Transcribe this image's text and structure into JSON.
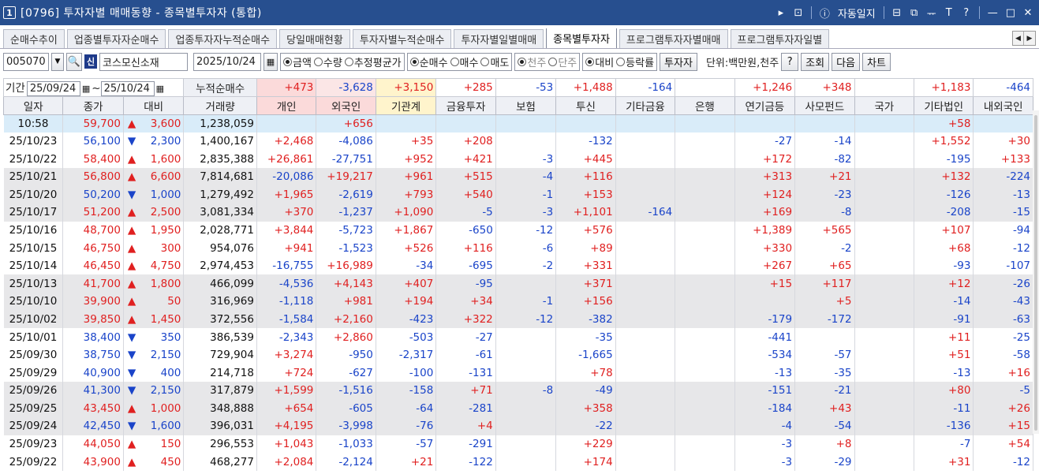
{
  "window": {
    "number_badge": "1",
    "title": "[0796] 투자자별 매매동향 - 종목별투자자 (통합)",
    "auto_journal": "자동일지",
    "controls": [
      "▸",
      "⊡",
      "ⓘ",
      "⧉",
      "⊟",
      "ᅲ",
      "T",
      "?",
      "—",
      "□",
      "✕"
    ]
  },
  "tabs": [
    {
      "label": "순매수추이",
      "active": false
    },
    {
      "label": "업종별투자자순매수",
      "active": false
    },
    {
      "label": "업종투자자누적순매수",
      "active": false
    },
    {
      "label": "당일매매현황",
      "active": false
    },
    {
      "label": "투자자별누적순매수",
      "active": false
    },
    {
      "label": "투자자별일별매매",
      "active": false
    },
    {
      "label": "종목별투자자",
      "active": true
    },
    {
      "label": "프로그램투자자별매매",
      "active": false
    },
    {
      "label": "프로그램투자자일별",
      "active": false
    }
  ],
  "toolbar": {
    "stock_code": "005070",
    "market_badge": "신",
    "stock_name": "코스모신소재",
    "date": "2025/10/24",
    "mode_options": [
      {
        "label": "금액",
        "on": true
      },
      {
        "label": "수량",
        "on": false
      },
      {
        "label": "추정평균가",
        "on": false
      }
    ],
    "trade_options": [
      {
        "label": "순매수",
        "on": true
      },
      {
        "label": "매수",
        "on": false
      },
      {
        "label": "매도",
        "on": false
      }
    ],
    "unit_options": [
      {
        "label": "천주",
        "on": true
      },
      {
        "label": "단주",
        "on": false
      }
    ],
    "compare_options": [
      {
        "label": "대비",
        "on": true
      },
      {
        "label": "등락률",
        "on": false
      }
    ],
    "investor_button": "투자자",
    "unit_label": "단위:백만원,천주",
    "help_button": "?",
    "query_button": "조회",
    "next_button": "다음",
    "chart_button": "차트"
  },
  "period": {
    "label": "기간",
    "from": "25/09/24",
    "to": "25/10/24",
    "cumulative_label": "누적순매수"
  },
  "summary": [
    "+473",
    "-3,628",
    "+3,150",
    "+285",
    "-53",
    "+1,488",
    "-164",
    "",
    "+1,246",
    "+348",
    "",
    "+1,183",
    "-464"
  ],
  "columns": [
    "일자",
    "종가",
    "대비",
    "거래량",
    "개인",
    "외국인",
    "기관계",
    "금융투자",
    "보험",
    "투신",
    "기타금융",
    "은행",
    "연기금등",
    "사모펀드",
    "국가",
    "기타법인",
    "내외국인"
  ],
  "rows": [
    [
      "10:58",
      "59,700",
      "up",
      "3,600",
      "1,238,059",
      "",
      "+656",
      "",
      "",
      "",
      "",
      "",
      "",
      "",
      "",
      "",
      "+58",
      ""
    ],
    [
      "25/10/23",
      "56,100",
      "dn",
      "2,300",
      "1,400,167",
      "+2,468",
      "-4,086",
      "+35",
      "+208",
      "",
      "-132",
      "",
      "",
      "-27",
      "-14",
      "",
      "+1,552",
      "+30"
    ],
    [
      "25/10/22",
      "58,400",
      "up",
      "1,600",
      "2,835,388",
      "+26,861",
      "-27,751",
      "+952",
      "+421",
      "-3",
      "+445",
      "",
      "",
      "+172",
      "-82",
      "",
      "-195",
      "+133"
    ],
    [
      "25/10/21",
      "56,800",
      "up",
      "6,600",
      "7,814,681",
      "-20,086",
      "+19,217",
      "+961",
      "+515",
      "-4",
      "+116",
      "",
      "",
      "+313",
      "+21",
      "",
      "+132",
      "-224"
    ],
    [
      "25/10/20",
      "50,200",
      "dn",
      "1,000",
      "1,279,492",
      "+1,965",
      "-2,619",
      "+793",
      "+540",
      "-1",
      "+153",
      "",
      "",
      "+124",
      "-23",
      "",
      "-126",
      "-13"
    ],
    [
      "25/10/17",
      "51,200",
      "up",
      "2,500",
      "3,081,334",
      "+370",
      "-1,237",
      "+1,090",
      "-5",
      "-3",
      "+1,101",
      "-164",
      "",
      "+169",
      "-8",
      "",
      "-208",
      "-15"
    ],
    [
      "25/10/16",
      "48,700",
      "up",
      "1,950",
      "2,028,771",
      "+3,844",
      "-5,723",
      "+1,867",
      "-650",
      "-12",
      "+576",
      "",
      "",
      "+1,389",
      "+565",
      "",
      "+107",
      "-94"
    ],
    [
      "25/10/15",
      "46,750",
      "up",
      "300",
      "954,076",
      "+941",
      "-1,523",
      "+526",
      "+116",
      "-6",
      "+89",
      "",
      "",
      "+330",
      "-2",
      "",
      "+68",
      "-12"
    ],
    [
      "25/10/14",
      "46,450",
      "up",
      "4,750",
      "2,974,453",
      "-16,755",
      "+16,989",
      "-34",
      "-695",
      "-2",
      "+331",
      "",
      "",
      "+267",
      "+65",
      "",
      "-93",
      "-107"
    ],
    [
      "25/10/13",
      "41,700",
      "up",
      "1,800",
      "466,099",
      "-4,536",
      "+4,143",
      "+407",
      "-95",
      "",
      "+371",
      "",
      "",
      "+15",
      "+117",
      "",
      "+12",
      "-26"
    ],
    [
      "25/10/10",
      "39,900",
      "up",
      "50",
      "316,969",
      "-1,118",
      "+981",
      "+194",
      "+34",
      "-1",
      "+156",
      "",
      "",
      "",
      "+5",
      "",
      "-14",
      "-43"
    ],
    [
      "25/10/02",
      "39,850",
      "up",
      "1,450",
      "372,556",
      "-1,584",
      "+2,160",
      "-423",
      "+322",
      "-12",
      "-382",
      "",
      "",
      "-179",
      "-172",
      "",
      "-91",
      "-63"
    ],
    [
      "25/10/01",
      "38,400",
      "dn",
      "350",
      "386,539",
      "-2,343",
      "+2,860",
      "-503",
      "-27",
      "",
      "-35",
      "",
      "",
      "-441",
      "",
      "",
      "+11",
      "-25"
    ],
    [
      "25/09/30",
      "38,750",
      "dn",
      "2,150",
      "729,904",
      "+3,274",
      "-950",
      "-2,317",
      "-61",
      "",
      "-1,665",
      "",
      "",
      "-534",
      "-57",
      "",
      "+51",
      "-58"
    ],
    [
      "25/09/29",
      "40,900",
      "dn",
      "400",
      "214,718",
      "+724",
      "-627",
      "-100",
      "-131",
      "",
      "+78",
      "",
      "",
      "-13",
      "-35",
      "",
      "-13",
      "+16"
    ],
    [
      "25/09/26",
      "41,300",
      "dn",
      "2,150",
      "317,879",
      "+1,599",
      "-1,516",
      "-158",
      "+71",
      "-8",
      "-49",
      "",
      "",
      "-151",
      "-21",
      "",
      "+80",
      "-5"
    ],
    [
      "25/09/25",
      "43,450",
      "up",
      "1,000",
      "348,888",
      "+654",
      "-605",
      "-64",
      "-281",
      "",
      "+358",
      "",
      "",
      "-184",
      "+43",
      "",
      "-11",
      "+26"
    ],
    [
      "25/09/24",
      "42,450",
      "dn",
      "1,600",
      "396,031",
      "+4,195",
      "-3,998",
      "-76",
      "+4",
      "",
      "-22",
      "",
      "",
      "-4",
      "-54",
      "",
      "-136",
      "+15"
    ],
    [
      "25/09/23",
      "44,050",
      "up",
      "150",
      "296,553",
      "+1,043",
      "-1,033",
      "-57",
      "-291",
      "",
      "+229",
      "",
      "",
      "-3",
      "+8",
      "",
      "-7",
      "+54"
    ],
    [
      "25/09/22",
      "43,900",
      "up",
      "450",
      "468,277",
      "+2,084",
      "-2,124",
      "+21",
      "-122",
      "",
      "+174",
      "",
      "",
      "-3",
      "-29",
      "",
      "+31",
      "-12"
    ]
  ],
  "shaded_rows": [
    3,
    4,
    5,
    9,
    10,
    11,
    15,
    16,
    17
  ],
  "colors": {
    "up": "#e02020",
    "down": "#1a44c9",
    "title_bar": "#274f8f"
  }
}
